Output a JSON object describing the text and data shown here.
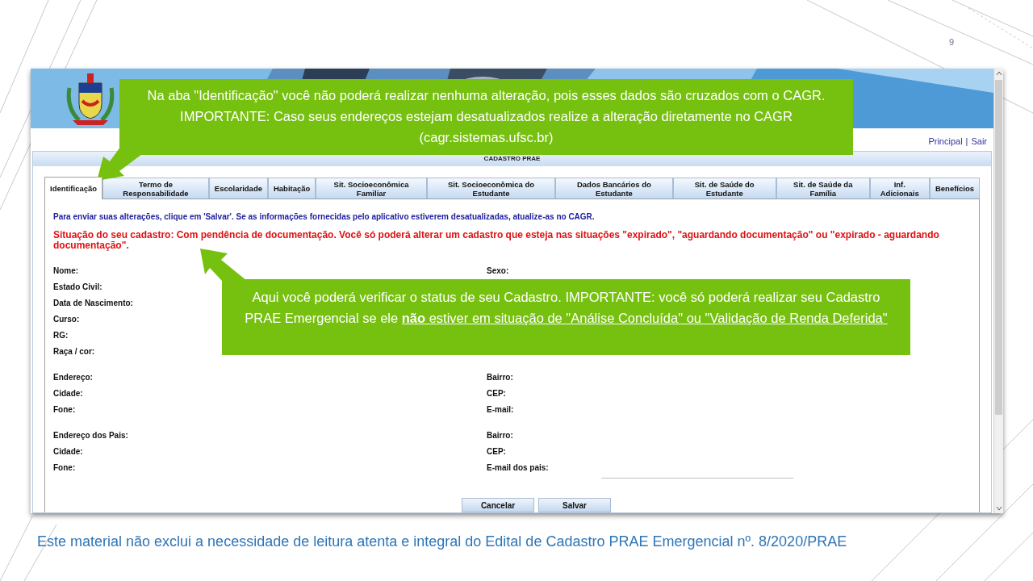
{
  "slide_number": "9",
  "header_links": {
    "items": [
      "Principal",
      "Sair"
    ],
    "separator": "|"
  },
  "panel_title": "CADASTRO PRAE",
  "tabs": [
    {
      "label": "Identificação",
      "selected": true
    },
    {
      "label": "Termo de Responsabilidade",
      "selected": false
    },
    {
      "label": "Escolaridade",
      "selected": false
    },
    {
      "label": "Habitação",
      "selected": false
    },
    {
      "label": "Sit. Socioeconômica Familiar",
      "selected": false
    },
    {
      "label": "Sit. Socioeconômica do Estudante",
      "selected": false
    },
    {
      "label": "Dados Bancários do Estudante",
      "selected": false
    },
    {
      "label": "Sit. de Saúde do Estudante",
      "selected": false
    },
    {
      "label": "Sit. de Saúde da Família",
      "selected": false
    },
    {
      "label": "Inf. Adicionais",
      "selected": false
    },
    {
      "label": "Benefícios",
      "selected": false
    }
  ],
  "info_message": "Para enviar suas alterações, clique em 'Salvar'. Se as informações fornecidas pelo aplicativo estiverem desatualizadas, atualize-as no CAGR.",
  "status_message": "Situação do seu cadastro: Com pendência de documentação. Você só poderá alterar um cadastro que esteja nas situações \"expirado\", \"aguardando documentação\" ou \"expirado - aguardando documentação\".",
  "field_groups": [
    {
      "rows": [
        {
          "kind": "label",
          "left": "Nome:",
          "right": "Sexo:"
        },
        {
          "kind": "label",
          "left": "Estado Civil:"
        },
        {
          "kind": "label",
          "left": "Data de Nascimento:"
        },
        {
          "kind": "label",
          "left": "Curso:"
        },
        {
          "kind": "label",
          "left": "RG:"
        },
        {
          "kind": "label",
          "left": "Raça / cor:"
        }
      ]
    },
    {
      "rows": [
        {
          "kind": "label",
          "left": "Endereço:",
          "right": "Bairro:"
        },
        {
          "kind": "label",
          "left": "Cidade:",
          "right": "CEP:"
        },
        {
          "kind": "label",
          "left": "Fone:",
          "right": "E-mail:"
        }
      ]
    },
    {
      "rows": [
        {
          "kind": "label",
          "left": "Endereço dos Pais:",
          "right": "Bairro:"
        },
        {
          "kind": "label",
          "left": "Cidade:",
          "right": "CEP:"
        },
        {
          "kind": "input",
          "left": "Fone:",
          "right": "E-mail dos pais:"
        }
      ]
    }
  ],
  "buttons": [
    "Cancelar",
    "Salvar"
  ],
  "callouts": [
    {
      "segments": [
        {
          "text": "Na aba \"Identificação\" você não poderá realizar nenhuma alteração, pois esses dados são cruzados com o CAGR. IMPORTANTE: Caso seus endereços estejam desatualizados realize a alteração diretamente no CAGR (cagr.sistemas.ufsc.br)",
          "underline": false
        }
      ]
    },
    {
      "segments": [
        {
          "text": "Aqui você poderá verificar o status de seu Cadastro. IMPORTANTE: você só poderá realizar seu Cadastro PRAE Emergencial se ele ",
          "underline": false
        },
        {
          "text": "**não** estiver em situação de \"Análise Concluída\" ou \"Validação de Renda Deferida\"",
          "underline": true
        }
      ]
    }
  ],
  "footer": "Este material não exclui a necessidade de leitura atenta e integral do Edital de Cadastro PRAE Emergencial nº. 8/2020/PRAE"
}
